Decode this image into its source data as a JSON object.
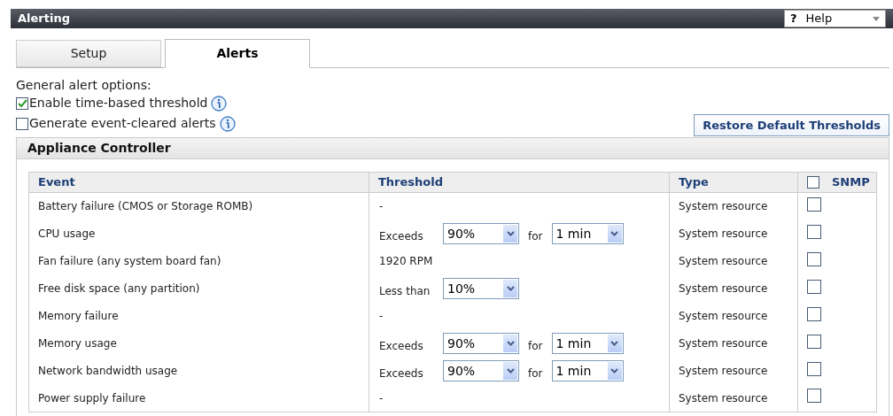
{
  "window": {
    "title": "Alerting"
  },
  "help": {
    "icon": "?",
    "label": "Help"
  },
  "tabs": [
    {
      "label": "Setup",
      "selected": false
    },
    {
      "label": "Alerts",
      "selected": true
    }
  ],
  "options": {
    "heading": "General alert options:",
    "items": [
      {
        "label": "Enable time-based threshold",
        "checked": true
      },
      {
        "label": "Generate event-cleared alerts",
        "checked": false
      }
    ]
  },
  "restore_button": "Restore Default Thresholds",
  "section": {
    "title": "Appliance Controller",
    "table": {
      "columns": [
        "Event",
        "Threshold",
        "Type",
        "SNMP"
      ],
      "snmp_all_checked": false,
      "rows": [
        {
          "event": "Battery failure (CMOS or Storage ROMB)",
          "threshold": {
            "kind": "text",
            "text": "-"
          },
          "type": "System resource",
          "snmp": false
        },
        {
          "event": "CPU usage",
          "threshold": {
            "kind": "controls",
            "label": "Exceeds",
            "value": "90%",
            "connector": "for",
            "duration": "1 min"
          },
          "type": "System resource",
          "snmp": false
        },
        {
          "event": "Fan failure (any system board fan)",
          "threshold": {
            "kind": "text",
            "text": "1920 RPM"
          },
          "type": "System resource",
          "snmp": false
        },
        {
          "event": "Free disk space (any partition)",
          "threshold": {
            "kind": "controls",
            "label": "Less than",
            "value": "10%"
          },
          "type": "System resource",
          "snmp": false
        },
        {
          "event": "Memory failure",
          "threshold": {
            "kind": "text",
            "text": "-"
          },
          "type": "System resource",
          "snmp": false
        },
        {
          "event": "Memory usage",
          "threshold": {
            "kind": "controls",
            "label": "Exceeds",
            "value": "90%",
            "connector": "for",
            "duration": "1 min"
          },
          "type": "System resource",
          "snmp": false
        },
        {
          "event": "Network bandwidth usage",
          "threshold": {
            "kind": "controls",
            "label": "Exceeds",
            "value": "90%",
            "connector": "for",
            "duration": "1 min"
          },
          "type": "System resource",
          "snmp": false
        },
        {
          "event": "Power supply failure",
          "threshold": {
            "kind": "text",
            "text": "-"
          },
          "type": "System resource",
          "snmp": false
        }
      ]
    }
  }
}
